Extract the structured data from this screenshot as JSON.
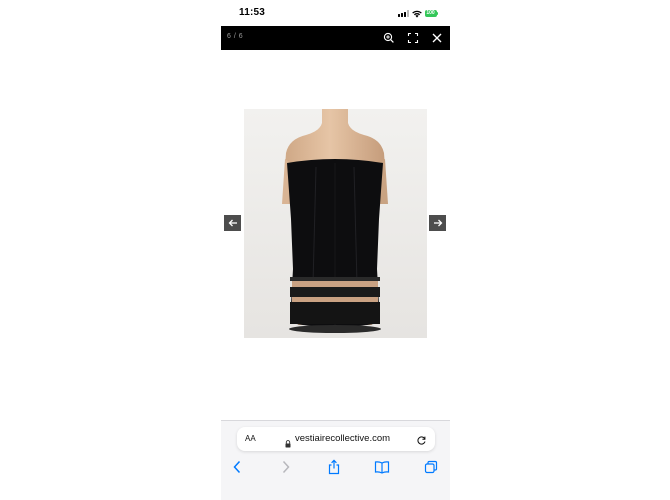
{
  "status_bar": {
    "time": "11:53",
    "battery_label": "100",
    "signal_icon": "cellular-signal-icon",
    "wifi_icon": "wifi-icon",
    "battery_icon": "battery-icon",
    "battery_color": "#34c759"
  },
  "viewer": {
    "counter": "6 / 6",
    "zoom_icon": "zoom-in-icon",
    "fullscreen_icon": "fullscreen-icon",
    "close_icon": "close-icon",
    "prev_icon": "arrow-left-icon",
    "next_icon": "arrow-right-icon"
  },
  "photo": {
    "subject": "black strapless mini dress on mannequin"
  },
  "browser": {
    "text_size_label": "AA",
    "url": "vestiairecollective.com",
    "lock_icon": "lock-icon",
    "reload_icon": "reload-icon",
    "toolbar": [
      "back-icon",
      "forward-icon",
      "share-icon",
      "bookmarks-icon",
      "tabs-icon"
    ],
    "accent_color": "#007aff"
  }
}
